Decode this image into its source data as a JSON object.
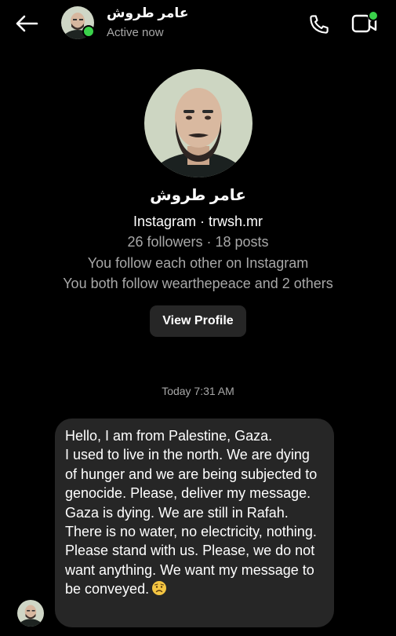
{
  "header": {
    "name": "عامر طروش",
    "status": "Active now",
    "back_icon": "arrow-left-icon",
    "call_icon": "phone-icon",
    "video_icon": "video-camera-icon"
  },
  "profile": {
    "name": "عامر طروش",
    "handle": "Instagram · trwsh.mr",
    "stats": "26 followers · 18 posts",
    "mutual": "You follow each other on Instagram",
    "common": "You both follow wearthepeace and 2 others",
    "view_profile_label": "View Profile"
  },
  "conversation": {
    "timestamp": "Today 7:31 AM",
    "messages": [
      {
        "text": "Hello, I am from Palestine, Gaza.\nI used to live in the north. We are dying of hunger and we are being subjected to genocide. Please, deliver my message. Gaza is dying. We are still in Rafah. There is no water, no electricity, nothing. Please stand with us. Please, we do not want anything. We want my message to be conveyed.",
        "emoji": "sad-face-icon"
      }
    ]
  },
  "colors": {
    "background": "#000000",
    "bubble": "#262626",
    "secondary_text": "#a8a8a8",
    "online": "#3ad14a"
  }
}
